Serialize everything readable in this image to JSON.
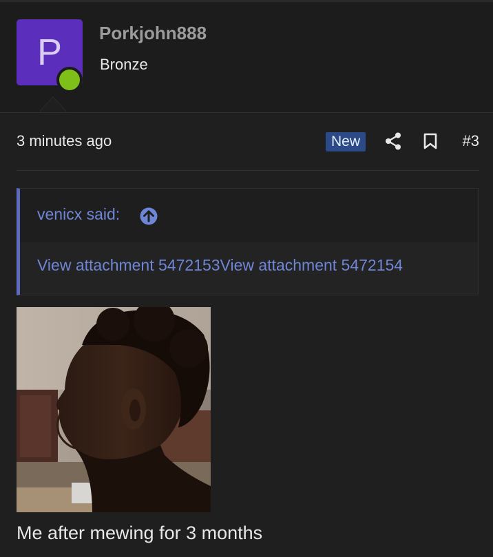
{
  "user": {
    "avatar_letter": "P",
    "avatar_color": "#5b2fbb",
    "online_color": "#7fbf1a",
    "username": "Porkjohn888",
    "title": "Bronze"
  },
  "post_meta": {
    "timestamp": "3 minutes ago",
    "new_badge": "New",
    "share_icon": "share-icon",
    "bookmark_icon": "bookmark-icon",
    "post_number": "#3"
  },
  "quote": {
    "author_label": "venicx said:",
    "jump_icon": "arrow-up-circle-icon",
    "attachments": [
      "View attachment 5472153",
      "View attachment 5472154"
    ],
    "accent_color": "#5c6bc0",
    "link_color": "#6f86d6"
  },
  "post": {
    "image_alt": "side profile photo of a person in a kitchen",
    "caption": "Me after mewing for 3 months"
  }
}
